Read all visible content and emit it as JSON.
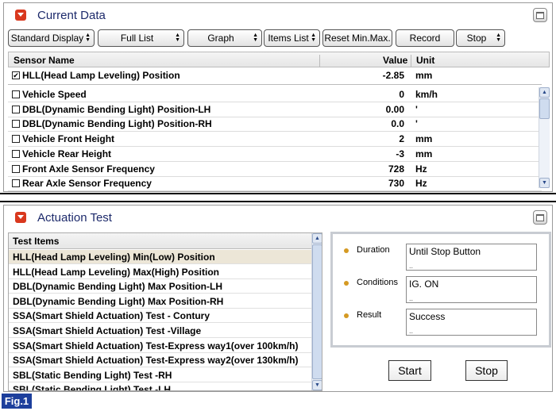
{
  "current_data": {
    "title": "Current Data",
    "toolbar": {
      "standard_display": "Standard Display",
      "full_list": "Full List",
      "graph": "Graph",
      "items_list": "Items List",
      "reset_min_max": "Reset Min.Max.",
      "record": "Record",
      "stop": "Stop"
    },
    "columns": {
      "name": "Sensor Name",
      "value": "Value",
      "unit": "Unit"
    },
    "pinned_row": {
      "name": "HLL(Head Lamp Leveling) Position",
      "value": "-2.85",
      "unit": "mm",
      "checked": true
    },
    "rows": [
      {
        "name": "Vehicle Speed",
        "value": "0",
        "unit": "km/h"
      },
      {
        "name": "DBL(Dynamic Bending Light) Position-LH",
        "value": "0.00",
        "unit": "'"
      },
      {
        "name": "DBL(Dynamic Bending Light) Position-RH",
        "value": "0.0",
        "unit": "'"
      },
      {
        "name": "Vehicle Front Height",
        "value": "2",
        "unit": "mm"
      },
      {
        "name": "Vehicle Rear Height",
        "value": "-3",
        "unit": "mm"
      },
      {
        "name": "Front Axle Sensor Frequency",
        "value": "728",
        "unit": "Hz"
      },
      {
        "name": "Rear Axle Sensor Frequency",
        "value": "730",
        "unit": "Hz"
      }
    ]
  },
  "actuation_test": {
    "title": "Actuation Test",
    "list_header": "Test Items",
    "items": [
      "HLL(Head Lamp Leveling) Min(Low) Position",
      "HLL(Head Lamp Leveling) Max(High) Position",
      "DBL(Dynamic Bending Light) Max Position-LH",
      "DBL(Dynamic Bending Light) Max Position-RH",
      "SSA(Smart Shield Actuation) Test - Contury",
      "SSA(Smart Shield Actuation) Test -Village",
      "SSA(Smart Shield Actuation) Test-Express way1(over 100km/h)",
      "SSA(Smart Shield Actuation) Test-Express way2(over 130km/h)",
      "SBL(Static Bending Light) Test -RH",
      "SBL(Static Bending Light) Test -LH"
    ],
    "selected_index": 0,
    "info": {
      "duration_label": "Duration",
      "duration_value": "Until Stop Button",
      "conditions_label": "Conditions",
      "conditions_value": "IG. ON",
      "result_label": "Result",
      "result_value": "Success"
    },
    "start_label": "Start",
    "stop_label": "Stop"
  },
  "figure_label": "Fig.1",
  "colors": {
    "title": "#1d2a6b",
    "collapse": "#d9381e",
    "fig_bg": "#1d3f9c",
    "selected_row": "#ece6d7"
  }
}
